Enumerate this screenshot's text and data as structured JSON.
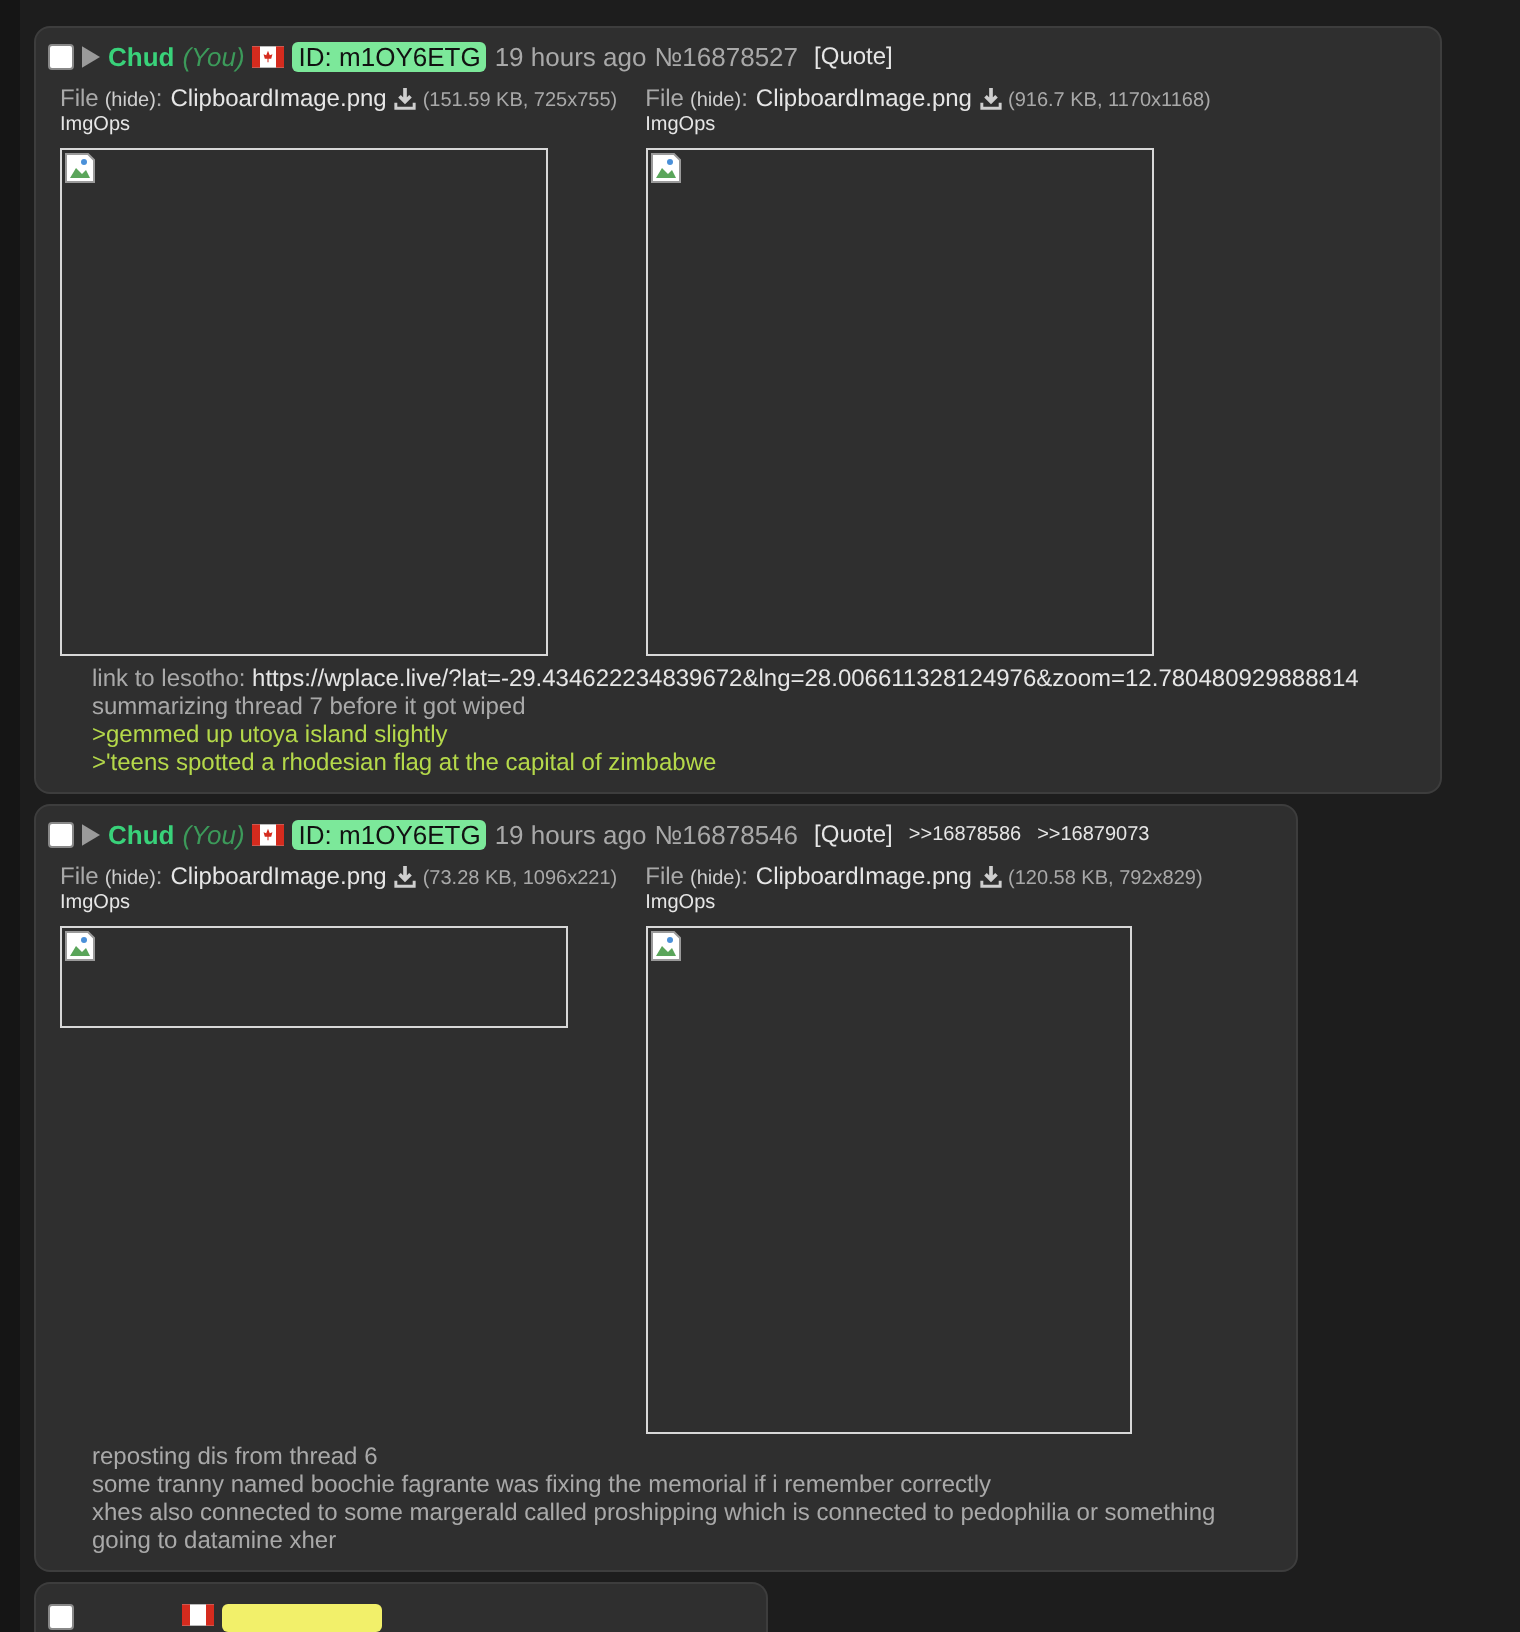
{
  "posts": [
    {
      "checked": false,
      "name": "Chud",
      "you": "(You)",
      "id": "ID: m1OY6ETG",
      "time": "19 hours ago",
      "number": "№16878527",
      "quote": "[Quote]",
      "files": [
        {
          "label": "File",
          "hide": "(hide)",
          "colon": ":",
          "filename": "ClipboardImage.png",
          "size": "(151.59 KB, 725x755)",
          "imgops": "ImgOps"
        },
        {
          "label": "File",
          "hide": "(hide)",
          "colon": ":",
          "filename": "ClipboardImage.png",
          "size": "(916.7 KB, 1170x1168)",
          "imgops": "ImgOps"
        }
      ],
      "lines": [
        {
          "kind": "link",
          "prefix": "link to lesotho: ",
          "url": "https://wplace.live/?lat=-29.434622234839672&lng=28.006611328124976&zoom=12.780480929888814"
        },
        {
          "kind": "text",
          "text": "summarizing thread 7 before it got wiped"
        },
        {
          "kind": "greentext",
          "text": ">gemmed up utoya island slightly"
        },
        {
          "kind": "greentext",
          "text": ">'teens spotted a rhodesian flag at the capital of zimbabwe"
        }
      ]
    },
    {
      "checked": false,
      "name": "Chud",
      "you": "(You)",
      "id": "ID: m1OY6ETG",
      "time": "19 hours ago",
      "number": "№16878546",
      "quote": "[Quote]",
      "backlinks": [
        ">>16878586",
        ">>16879073"
      ],
      "files": [
        {
          "label": "File",
          "hide": "(hide)",
          "colon": ":",
          "filename": "ClipboardImage.png",
          "size": "(73.28 KB, 1096x221)",
          "imgops": "ImgOps"
        },
        {
          "label": "File",
          "hide": "(hide)",
          "colon": ":",
          "filename": "ClipboardImage.png",
          "size": "(120.58 KB, 792x829)",
          "imgops": "ImgOps"
        }
      ],
      "lines": [
        {
          "kind": "text",
          "text": "reposting dis from thread 6"
        },
        {
          "kind": "text",
          "text": "some tranny named boochie fagrante was fixing the memorial if i remember correctly"
        },
        {
          "kind": "text",
          "text": "xhes also connected to some margerald called proshipping which is connected to pedophilia or something"
        },
        {
          "kind": "text",
          "text": "going to datamine xher"
        }
      ]
    }
  ],
  "partial_post": {
    "checked": false
  }
}
